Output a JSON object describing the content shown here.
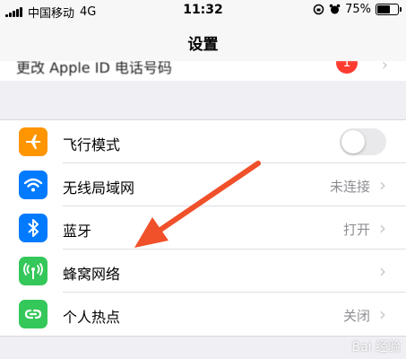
{
  "status_bar": {
    "carrier": "中国移动",
    "network": "4G",
    "time": "11:32",
    "battery": "75%",
    "battery_level": 0.75
  },
  "nav": {
    "title": "设置"
  },
  "top_row": {
    "label": "更改 Apple ID 电话号码",
    "badge": "1"
  },
  "rows": [
    {
      "label": "飞行模式",
      "icon": "airplane-icon",
      "icon_color": "#ff9500",
      "toggle_on": false
    },
    {
      "label": "无线局域网",
      "icon": "wifi-icon",
      "icon_color": "#007aff",
      "value": "未连接"
    },
    {
      "label": "蓝牙",
      "icon": "bluetooth-icon",
      "icon_color": "#007aff",
      "value": "打开"
    },
    {
      "label": "蜂窝网络",
      "icon": "cellular-icon",
      "icon_color": "#34c759",
      "value": ""
    },
    {
      "label": "个人热点",
      "icon": "hotspot-icon",
      "icon_color": "#34c759",
      "value": "关闭"
    }
  ],
  "annotation_color": "#f0502a",
  "watermark": "Bai 经验"
}
